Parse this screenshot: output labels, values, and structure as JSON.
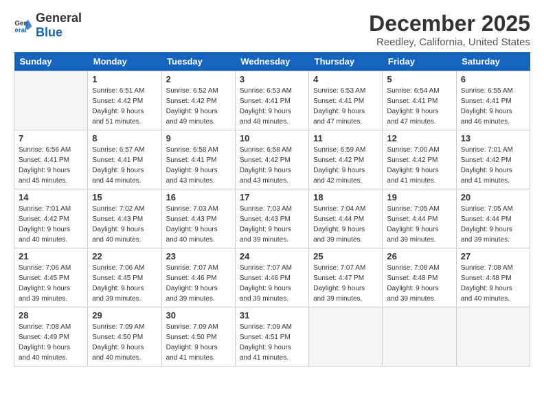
{
  "header": {
    "logo_general": "General",
    "logo_blue": "Blue",
    "title": "December 2025",
    "subtitle": "Reedley, California, United States"
  },
  "weekdays": [
    "Sunday",
    "Monday",
    "Tuesday",
    "Wednesday",
    "Thursday",
    "Friday",
    "Saturday"
  ],
  "weeks": [
    [
      {
        "day": "",
        "empty": true
      },
      {
        "day": "1",
        "sunrise": "6:51 AM",
        "sunset": "4:42 PM",
        "daylight": "9 hours and 51 minutes."
      },
      {
        "day": "2",
        "sunrise": "6:52 AM",
        "sunset": "4:42 PM",
        "daylight": "9 hours and 49 minutes."
      },
      {
        "day": "3",
        "sunrise": "6:53 AM",
        "sunset": "4:41 PM",
        "daylight": "9 hours and 48 minutes."
      },
      {
        "day": "4",
        "sunrise": "6:53 AM",
        "sunset": "4:41 PM",
        "daylight": "9 hours and 47 minutes."
      },
      {
        "day": "5",
        "sunrise": "6:54 AM",
        "sunset": "4:41 PM",
        "daylight": "9 hours and 47 minutes."
      },
      {
        "day": "6",
        "sunrise": "6:55 AM",
        "sunset": "4:41 PM",
        "daylight": "9 hours and 46 minutes."
      }
    ],
    [
      {
        "day": "7",
        "sunrise": "6:56 AM",
        "sunset": "4:41 PM",
        "daylight": "9 hours and 45 minutes."
      },
      {
        "day": "8",
        "sunrise": "6:57 AM",
        "sunset": "4:41 PM",
        "daylight": "9 hours and 44 minutes."
      },
      {
        "day": "9",
        "sunrise": "6:58 AM",
        "sunset": "4:41 PM",
        "daylight": "9 hours and 43 minutes."
      },
      {
        "day": "10",
        "sunrise": "6:58 AM",
        "sunset": "4:42 PM",
        "daylight": "9 hours and 43 minutes."
      },
      {
        "day": "11",
        "sunrise": "6:59 AM",
        "sunset": "4:42 PM",
        "daylight": "9 hours and 42 minutes."
      },
      {
        "day": "12",
        "sunrise": "7:00 AM",
        "sunset": "4:42 PM",
        "daylight": "9 hours and 41 minutes."
      },
      {
        "day": "13",
        "sunrise": "7:01 AM",
        "sunset": "4:42 PM",
        "daylight": "9 hours and 41 minutes."
      }
    ],
    [
      {
        "day": "14",
        "sunrise": "7:01 AM",
        "sunset": "4:42 PM",
        "daylight": "9 hours and 40 minutes."
      },
      {
        "day": "15",
        "sunrise": "7:02 AM",
        "sunset": "4:43 PM",
        "daylight": "9 hours and 40 minutes."
      },
      {
        "day": "16",
        "sunrise": "7:03 AM",
        "sunset": "4:43 PM",
        "daylight": "9 hours and 40 minutes."
      },
      {
        "day": "17",
        "sunrise": "7:03 AM",
        "sunset": "4:43 PM",
        "daylight": "9 hours and 39 minutes."
      },
      {
        "day": "18",
        "sunrise": "7:04 AM",
        "sunset": "4:44 PM",
        "daylight": "9 hours and 39 minutes."
      },
      {
        "day": "19",
        "sunrise": "7:05 AM",
        "sunset": "4:44 PM",
        "daylight": "9 hours and 39 minutes."
      },
      {
        "day": "20",
        "sunrise": "7:05 AM",
        "sunset": "4:44 PM",
        "daylight": "9 hours and 39 minutes."
      }
    ],
    [
      {
        "day": "21",
        "sunrise": "7:06 AM",
        "sunset": "4:45 PM",
        "daylight": "9 hours and 39 minutes."
      },
      {
        "day": "22",
        "sunrise": "7:06 AM",
        "sunset": "4:45 PM",
        "daylight": "9 hours and 39 minutes."
      },
      {
        "day": "23",
        "sunrise": "7:07 AM",
        "sunset": "4:46 PM",
        "daylight": "9 hours and 39 minutes."
      },
      {
        "day": "24",
        "sunrise": "7:07 AM",
        "sunset": "4:46 PM",
        "daylight": "9 hours and 39 minutes."
      },
      {
        "day": "25",
        "sunrise": "7:07 AM",
        "sunset": "4:47 PM",
        "daylight": "9 hours and 39 minutes."
      },
      {
        "day": "26",
        "sunrise": "7:08 AM",
        "sunset": "4:48 PM",
        "daylight": "9 hours and 39 minutes."
      },
      {
        "day": "27",
        "sunrise": "7:08 AM",
        "sunset": "4:48 PM",
        "daylight": "9 hours and 40 minutes."
      }
    ],
    [
      {
        "day": "28",
        "sunrise": "7:08 AM",
        "sunset": "4:49 PM",
        "daylight": "9 hours and 40 minutes."
      },
      {
        "day": "29",
        "sunrise": "7:09 AM",
        "sunset": "4:50 PM",
        "daylight": "9 hours and 40 minutes."
      },
      {
        "day": "30",
        "sunrise": "7:09 AM",
        "sunset": "4:50 PM",
        "daylight": "9 hours and 41 minutes."
      },
      {
        "day": "31",
        "sunrise": "7:09 AM",
        "sunset": "4:51 PM",
        "daylight": "9 hours and 41 minutes."
      },
      {
        "day": "",
        "empty": true
      },
      {
        "day": "",
        "empty": true
      },
      {
        "day": "",
        "empty": true
      }
    ]
  ],
  "labels": {
    "sunrise_prefix": "Sunrise:",
    "sunset_prefix": "Sunset:",
    "daylight_prefix": "Daylight:"
  }
}
